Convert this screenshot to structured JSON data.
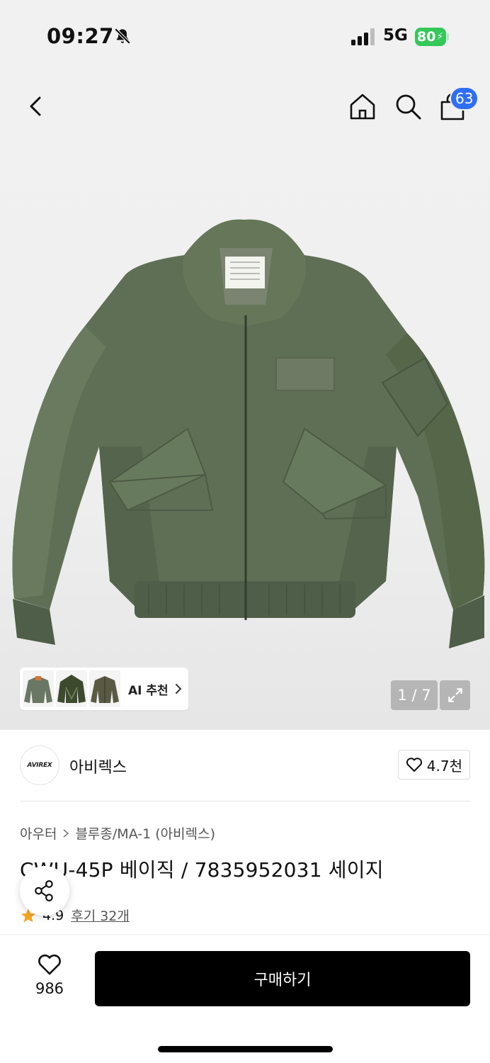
{
  "status_bar": {
    "time": "09:27",
    "network": "5G",
    "battery": "80",
    "icons": [
      "bell-muted-icon",
      "signal-icon",
      "battery-icon"
    ]
  },
  "nav": {
    "icons": [
      "back-icon",
      "home-icon",
      "search-icon",
      "shopping-bag-icon"
    ],
    "cart_badge": "63"
  },
  "gallery": {
    "ai_label": "AI 추천",
    "counter": "1 / 7",
    "thumbnail_count": 3
  },
  "brand": {
    "logo_text": "AVIREX",
    "name": "아비렉스",
    "likes": "4.7천"
  },
  "breadcrumb": {
    "category": "아우터",
    "subcategory": "블루종/MA-1 (아비렉스)"
  },
  "product": {
    "title": "CWU-45P 베이직 / 7835952031 세이지",
    "rating": "4.9",
    "reviews": "후기 32개"
  },
  "bottom_bar": {
    "wish_count": "986",
    "buy_label": "구매하기"
  },
  "colors": {
    "accent_blue": "#2f6df6",
    "battery_green": "#34c759",
    "star_orange": "#f5a623",
    "jacket_green": "#5f6f55"
  }
}
